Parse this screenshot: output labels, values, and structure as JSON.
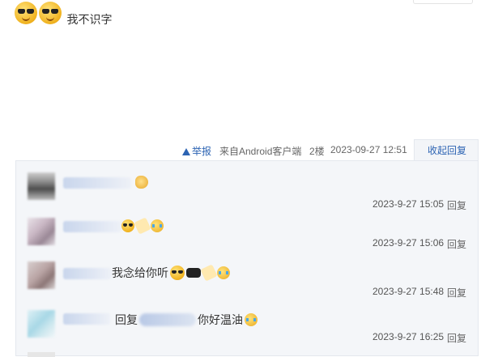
{
  "main_post": {
    "text": "我不识字"
  },
  "meta_bar": {
    "report_label": "举报",
    "source": "来自Android客户端",
    "floor": "2楼",
    "timestamp": "2023-09-27 12:51",
    "collapse_label": "收起回复"
  },
  "replies": [
    {
      "content": "",
      "date": "2023-9-27 15:05",
      "reply_label": "回复"
    },
    {
      "content": "",
      "date": "2023-9-27 15:06",
      "reply_label": "回复"
    },
    {
      "content": "我念给你听",
      "date": "2023-9-27 15:48",
      "reply_label": "回复"
    },
    {
      "content_prefix": "回复",
      "content": "你好温油",
      "date": "2023-9-27 16:25",
      "reply_label": "回复"
    }
  ],
  "colors": {
    "link_blue": "#2d64b3",
    "reply_bg": "#f4f6f9"
  }
}
